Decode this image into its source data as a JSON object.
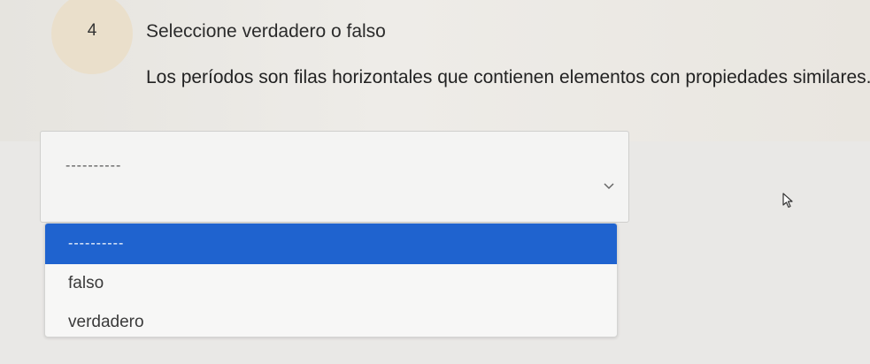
{
  "question": {
    "number": "4",
    "type_label": "Seleccione verdadero o falso",
    "text": "Los períodos son filas horizontales que contienen elementos con propiedades similares."
  },
  "select": {
    "current_value": "----------",
    "icon": "chevron-down-icon"
  },
  "dropdown": {
    "options": [
      {
        "label": "----------",
        "highlighted": true
      },
      {
        "label": "falso",
        "highlighted": false
      },
      {
        "label": "verdadero",
        "highlighted": false
      }
    ]
  },
  "colors": {
    "highlight": "#1f63cf",
    "badge": "#eadfcb"
  }
}
